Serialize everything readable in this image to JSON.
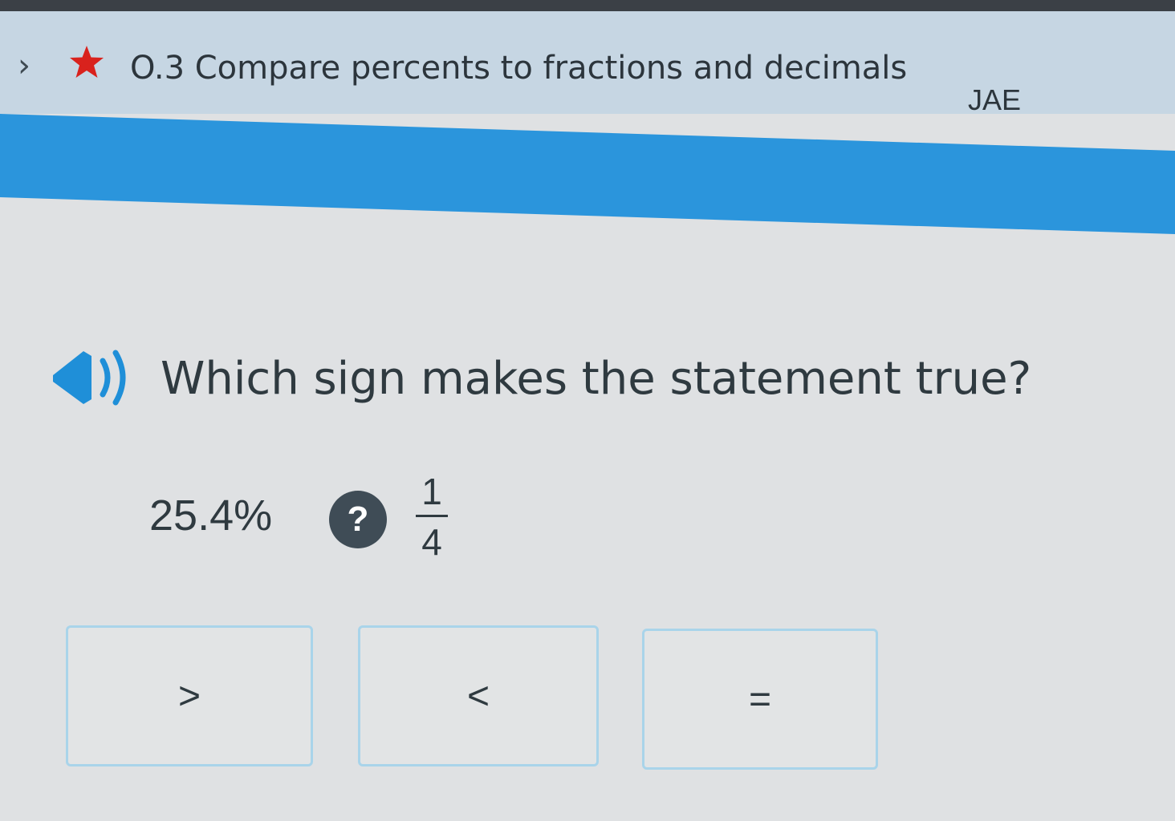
{
  "header": {
    "back_icon": "chevron-right-icon",
    "favorite_icon": "star-icon",
    "star_color": "#d9221d",
    "skill_title": "O.3 Compare percents to fractions and decimals",
    "user_code": "JAE"
  },
  "progress": {
    "accent_color": "#2b95dc"
  },
  "problem": {
    "audio_icon": "speaker-icon",
    "question": "Which sign makes the statement true?",
    "left_value": "25.4%",
    "unknown_symbol": "?",
    "right_numerator": "1",
    "right_denominator": "4"
  },
  "choices": [
    {
      "label": ">"
    },
    {
      "label": "<"
    },
    {
      "label": "="
    }
  ]
}
